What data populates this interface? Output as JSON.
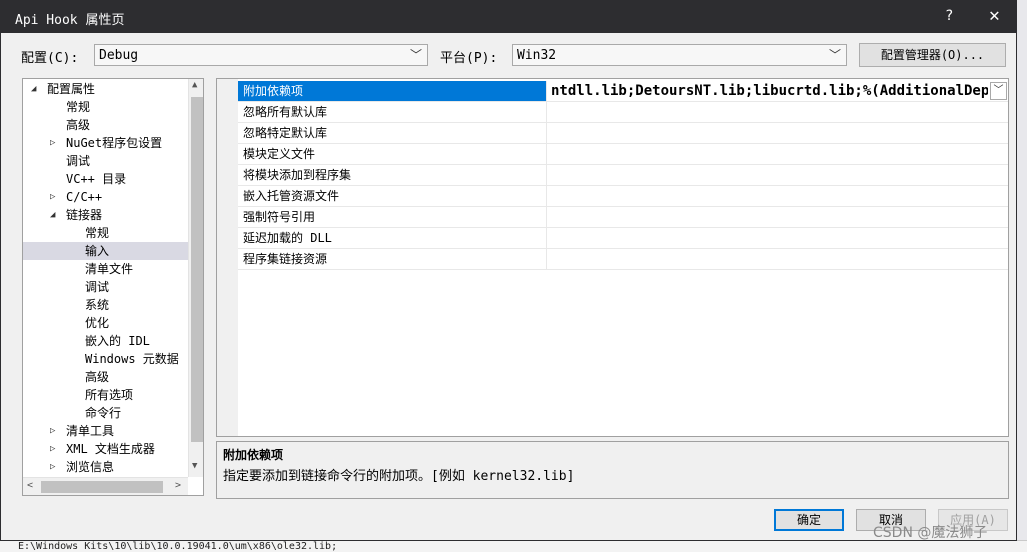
{
  "window": {
    "title": "Api Hook 属性页",
    "help": "?",
    "close": "✕"
  },
  "config": {
    "config_label": "配置(C):",
    "config_value": "Debug",
    "platform_label": "平台(P):",
    "platform_value": "Win32",
    "manager_label": "配置管理器(O)..."
  },
  "tree": {
    "items": [
      {
        "label": "配置属性",
        "twisty": "◢"
      },
      {
        "label": "常规",
        "twisty": ""
      },
      {
        "label": "高级",
        "twisty": ""
      },
      {
        "label": "NuGet程序包设置",
        "twisty": "▷"
      },
      {
        "label": "调试",
        "twisty": ""
      },
      {
        "label": "VC++ 目录",
        "twisty": ""
      },
      {
        "label": "C/C++",
        "twisty": "▷"
      },
      {
        "label": "链接器",
        "twisty": "◢"
      },
      {
        "label": "常规",
        "twisty": ""
      },
      {
        "label": "输入",
        "twisty": ""
      },
      {
        "label": "清单文件",
        "twisty": ""
      },
      {
        "label": "调试",
        "twisty": ""
      },
      {
        "label": "系统",
        "twisty": ""
      },
      {
        "label": "优化",
        "twisty": ""
      },
      {
        "label": "嵌入的 IDL",
        "twisty": ""
      },
      {
        "label": "Windows 元数据",
        "twisty": ""
      },
      {
        "label": "高级",
        "twisty": ""
      },
      {
        "label": "所有选项",
        "twisty": ""
      },
      {
        "label": "命令行",
        "twisty": ""
      },
      {
        "label": "清单工具",
        "twisty": "▷"
      },
      {
        "label": "XML 文档生成器",
        "twisty": "▷"
      },
      {
        "label": "浏览信息",
        "twisty": "▷"
      }
    ],
    "selected": "输入"
  },
  "properties": {
    "rows": [
      {
        "name": "附加依赖项",
        "value": "ntdll.lib;DetoursNT.lib;libucrtd.lib;%(AdditionalDependencies)"
      },
      {
        "name": "忽略所有默认库",
        "value": ""
      },
      {
        "name": "忽略特定默认库",
        "value": ""
      },
      {
        "name": "模块定义文件",
        "value": ""
      },
      {
        "name": "将模块添加到程序集",
        "value": ""
      },
      {
        "name": "嵌入托管资源文件",
        "value": ""
      },
      {
        "name": "强制符号引用",
        "value": ""
      },
      {
        "name": "延迟加载的 DLL",
        "value": ""
      },
      {
        "name": "程序集链接资源",
        "value": ""
      }
    ],
    "selected": "附加依赖项"
  },
  "description": {
    "title": "附加依赖项",
    "text": "指定要添加到链接命令行的附加项。[例如 kernel32.lib]"
  },
  "buttons": {
    "ok": "确定",
    "cancel": "取消",
    "apply": "应用(A)"
  },
  "background": {
    "output_line": "E:\\Windows Kits\\10\\lib\\10.0.19041.0\\um\\x86\\ole32.lib;"
  },
  "watermark": "CSDN @魔法狮子"
}
